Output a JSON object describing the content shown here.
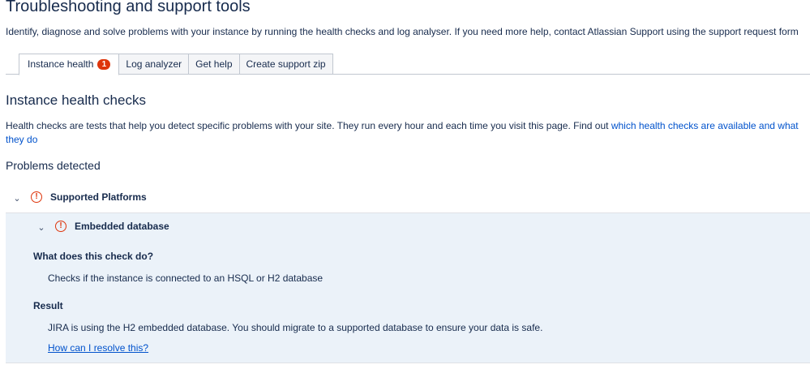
{
  "page": {
    "title": "Troubleshooting and support tools",
    "intro": "Identify, diagnose and solve problems with your instance by running the health checks and log analyser. If you need more help, contact Atlassian Support using the support request form"
  },
  "tabs": [
    {
      "label": "Instance health",
      "badge": "1",
      "active": true
    },
    {
      "label": "Log analyzer"
    },
    {
      "label": "Get help"
    },
    {
      "label": "Create support zip"
    }
  ],
  "health": {
    "title": "Instance health checks",
    "description": "Health checks are tests that help you detect specific problems with your site. They run every hour and each time you visit this page. Find out ",
    "link_text": "which health checks are available and what they do",
    "problems_heading": "Problems detected"
  },
  "group": {
    "label": "Supported Platforms",
    "check": {
      "label": "Embedded database",
      "what_heading": "What does this check do?",
      "what_text": "Checks if the instance is connected to an HSQL or H2 database",
      "result_heading": "Result",
      "result_text": "JIRA is using the H2 embedded database. You should migrate to a supported database to ensure your data is safe.",
      "resolve_link": "How can I resolve this?"
    }
  },
  "icons": {
    "chevron": "chevron-down-icon",
    "error": "error-circle-icon"
  },
  "colors": {
    "accent": "#0052cc",
    "error": "#de350b",
    "detail_bg": "#ebf2f9"
  }
}
